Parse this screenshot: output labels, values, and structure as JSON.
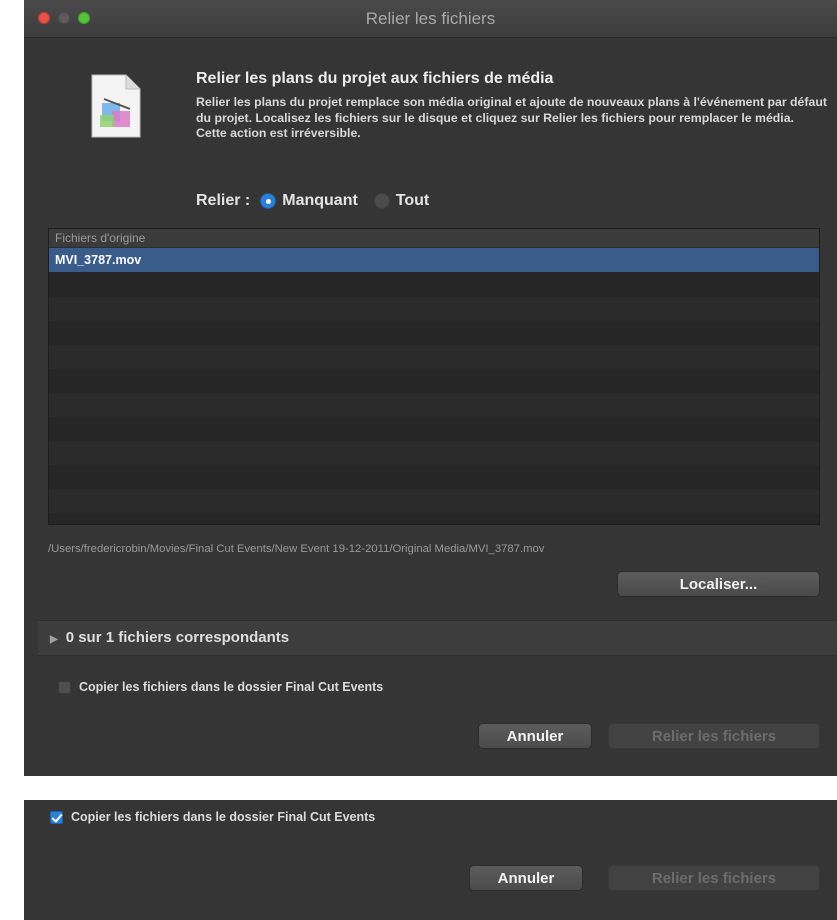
{
  "window": {
    "title": "Relier les fichiers",
    "heading": "Relier les plans du projet aux fichiers de média",
    "description": "Relier les plans du projet remplace son média original et ajoute de nouveaux plans à l'événement par défaut du projet. Localisez les fichiers sur le disque et cliquez sur Relier les fichiers pour remplacer le média. Cette action est irréversible.",
    "relier_label": "Relier :",
    "options": [
      {
        "label": "Manquant",
        "selected": true
      },
      {
        "label": "Tout",
        "selected": false
      }
    ],
    "list": {
      "header": "Fichiers d'origine",
      "rows": [
        "MVI_3787.mov"
      ]
    },
    "path": "/Users/fredericrobin/Movies/Final Cut Events/New Event 19-12-2011/Original Media/MVI_3787.mov",
    "localiser_label": "Localiser...",
    "matching_label": "0 sur 1 fichiers correspondants",
    "copy_label": "Copier les fichiers dans le dossier Final Cut Events",
    "copy_checked": false,
    "annuler_label": "Annuler",
    "relier_button_label": "Relier les fichiers"
  },
  "panel2": {
    "copy_label": "Copier les fichiers dans le dossier Final Cut Events",
    "copy_checked": true,
    "annuler_label": "Annuler",
    "relier_button_label": "Relier les fichiers"
  },
  "colors": {
    "accent": "#2d7fd8",
    "window_bg": "#353535",
    "selected_row": "#3a5c8a"
  }
}
